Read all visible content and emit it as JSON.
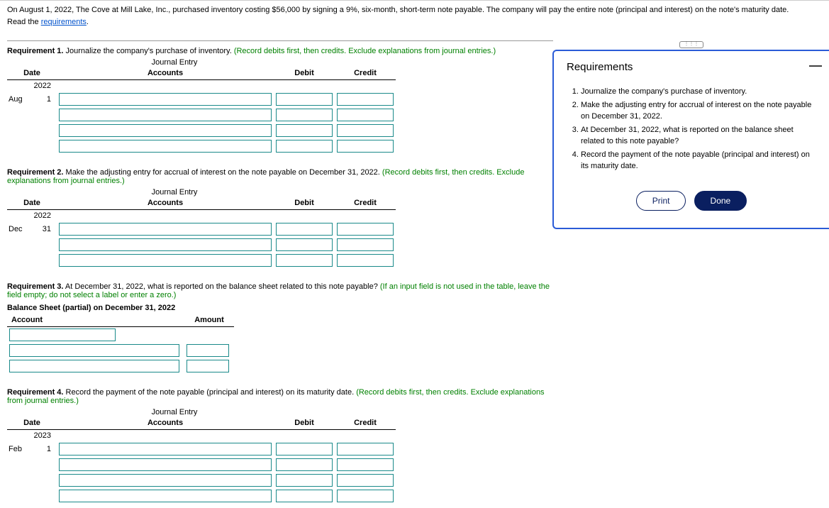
{
  "intro_text": "On August 1, 2022, The Cove at Mill Lake, Inc., purchased inventory costing $56,000 by signing a 9%, six-month, short-term note payable. The company will pay the entire note (principal and interest) on the note's maturity date.",
  "intro_read": "Read the ",
  "requirements_link": "requirements",
  "req1": {
    "label": "Requirement 1.",
    "text": " Journalize the company's purchase of inventory. ",
    "hint": "(Record debits first, then credits. Exclude explanations from journal entries.)",
    "je_title": "Journal Entry",
    "cols": {
      "date": "Date",
      "accounts": "Accounts",
      "debit": "Debit",
      "credit": "Credit"
    },
    "year": "2022",
    "month": "Aug",
    "day": "1"
  },
  "req2": {
    "label": "Requirement 2.",
    "text": " Make the adjusting entry for accrual of interest on the note payable on December 31, 2022. ",
    "hint": "(Record debits first, then credits. Exclude explanations from journal entries.)",
    "je_title": "Journal Entry",
    "cols": {
      "date": "Date",
      "accounts": "Accounts",
      "debit": "Debit",
      "credit": "Credit"
    },
    "year": "2022",
    "month": "Dec",
    "day": "31"
  },
  "req3": {
    "label": "Requirement 3.",
    "text": " At December 31, 2022, what is reported on the balance sheet related to this note payable? ",
    "hint": "(If an input field is not used in the table, leave the field empty; do not select a label or enter a zero.)",
    "bs_title": "Balance Sheet (partial) on December 31, 2022",
    "col_account": "Account",
    "col_amount": "Amount"
  },
  "req4": {
    "label": "Requirement 4.",
    "text": " Record the payment of the note payable (principal and interest) on its maturity date. ",
    "hint": "(Record debits first, then credits. Exclude explanations from journal entries.)",
    "je_title": "Journal Entry",
    "cols": {
      "date": "Date",
      "accounts": "Accounts",
      "debit": "Debit",
      "credit": "Credit"
    },
    "year": "2023",
    "month": "Feb",
    "day": "1"
  },
  "panel": {
    "title": "Requirements",
    "items": [
      "Journalize the company's purchase of inventory.",
      "Make the adjusting entry for accrual of interest on the note payable on December 31, 2022.",
      "At December 31, 2022, what is reported on the balance sheet related to this note payable?",
      "Record the payment of the note payable (principal and interest) on its maturity date."
    ],
    "print": "Print",
    "done": "Done"
  }
}
